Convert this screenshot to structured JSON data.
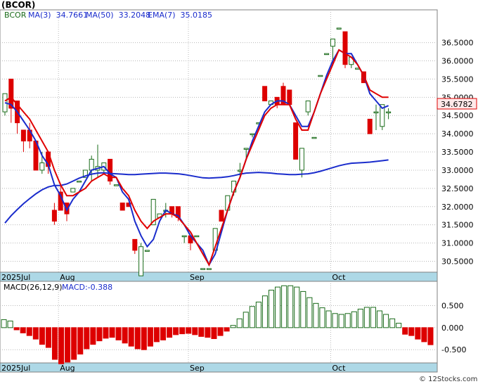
{
  "ticker_title": "(BCOR)",
  "watermark": "© 12Stocks.com",
  "colors": {
    "up": "#1a6b1a",
    "down": "#dd0000",
    "ma_fast": "#e00000",
    "ma_slow": "#1a2ccc",
    "axis_band": "#add8e6",
    "grid": "#b8b8b8",
    "price_tag_bg": "#ffe9e9",
    "macd_label": "#1a2ccc"
  },
  "chart_data": [
    {
      "type": "candlestick",
      "legend": {
        "symbol": "BCOR",
        "ma3": "MA(3)  34.7661",
        "ma50": "MA(50)  33.2048",
        "ema7": "EMA(7)  35.0185"
      },
      "last_price_tag": "34.6782",
      "ylim": [
        30.2,
        37.4
      ],
      "y_ticks": [
        "30.5000",
        "31.0000",
        "31.5000",
        "32.0000",
        "32.5000",
        "33.0000",
        "33.5000",
        "34.0000",
        "34.5000",
        "35.0000",
        "35.5000",
        "36.0000",
        "36.5000"
      ],
      "x_tick_labels": [
        {
          "label": "2025Jul",
          "index": 0
        },
        {
          "label": "Aug",
          "index": 9
        },
        {
          "label": "Sep",
          "index": 30
        },
        {
          "label": "Oct",
          "index": 53
        }
      ],
      "ohlc": [
        [
          34.6,
          35.1,
          34.5,
          35.1
        ],
        [
          35.5,
          35.5,
          34.3,
          34.7
        ],
        [
          34.9,
          34.9,
          34.0,
          34.3
        ],
        [
          34.1,
          34.1,
          33.5,
          33.8
        ],
        [
          34.1,
          34.3,
          33.6,
          33.8
        ],
        [
          33.8,
          33.8,
          33.0,
          33.0
        ],
        [
          33.0,
          33.5,
          32.9,
          33.2
        ],
        [
          33.5,
          33.5,
          32.9,
          33.1
        ],
        [
          31.9,
          32.1,
          31.5,
          31.6
        ],
        [
          32.4,
          32.6,
          31.9,
          31.9
        ],
        [
          32.1,
          32.1,
          31.6,
          31.8
        ],
        [
          32.4,
          32.5,
          32.4,
          32.5
        ],
        [
          32.7,
          32.7,
          32.7,
          32.7
        ],
        [
          32.8,
          33.0,
          32.8,
          33.0
        ],
        [
          33.0,
          33.4,
          32.7,
          33.3
        ],
        [
          33.0,
          33.7,
          32.8,
          33.1
        ],
        [
          33.0,
          33.2,
          32.9,
          33.2
        ],
        [
          33.3,
          33.3,
          32.6,
          32.7
        ],
        [
          32.6,
          32.6,
          32.6,
          32.6
        ],
        [
          32.1,
          32.1,
          31.9,
          31.9
        ],
        [
          32.1,
          32.1,
          32.0,
          32.0
        ],
        [
          31.1,
          31.1,
          30.7,
          30.8
        ],
        [
          30.1,
          31.0,
          30.1,
          30.9
        ],
        [
          30.8,
          30.8,
          30.8,
          30.8
        ],
        [
          31.5,
          32.2,
          31.5,
          32.2
        ],
        [
          31.7,
          31.8,
          31.7,
          31.8
        ],
        [
          31.9,
          32.1,
          31.7,
          31.9
        ],
        [
          32.0,
          32.0,
          31.7,
          31.8
        ],
        [
          32.0,
          32.0,
          31.6,
          31.7
        ],
        [
          31.2,
          31.2,
          31.0,
          31.2
        ],
        [
          31.2,
          31.2,
          30.8,
          31.0
        ],
        [
          31.2,
          31.2,
          31.2,
          31.2
        ],
        [
          30.3,
          30.3,
          30.3,
          30.3
        ],
        [
          30.3,
          30.3,
          30.3,
          30.3
        ],
        [
          30.8,
          31.4,
          30.8,
          31.4
        ],
        [
          31.9,
          31.9,
          31.6,
          31.6
        ],
        [
          31.9,
          32.3,
          31.9,
          32.3
        ],
        [
          32.4,
          32.7,
          32.3,
          32.7
        ],
        [
          33.0,
          33.2,
          32.8,
          33.0
        ],
        [
          33.6,
          33.6,
          33.3,
          33.6
        ],
        [
          34.0,
          34.0,
          33.9,
          34.0
        ],
        [
          34.3,
          34.3,
          34.3,
          34.3
        ],
        [
          35.3,
          35.3,
          34.9,
          34.9
        ],
        [
          34.8,
          34.9,
          34.8,
          34.9
        ],
        [
          35.0,
          35.0,
          34.7,
          34.8
        ],
        [
          35.3,
          35.4,
          34.8,
          34.8
        ],
        [
          35.2,
          35.2,
          34.8,
          34.8
        ],
        [
          34.3,
          34.3,
          33.3,
          33.3
        ],
        [
          33.0,
          33.6,
          32.8,
          33.6
        ],
        [
          34.6,
          34.9,
          34.5,
          34.9
        ],
        [
          33.9,
          33.9,
          33.9,
          33.9
        ],
        [
          35.6,
          35.6,
          35.6,
          35.6
        ],
        [
          36.2,
          36.2,
          36.2,
          36.2
        ],
        [
          36.4,
          36.6,
          35.9,
          36.6
        ],
        [
          36.9,
          36.9,
          36.9,
          36.9
        ],
        [
          36.8,
          36.8,
          35.8,
          35.9
        ],
        [
          35.9,
          36.1,
          35.8,
          36.1
        ],
        [
          35.8,
          35.8,
          35.8,
          35.8
        ],
        [
          35.7,
          35.7,
          35.4,
          35.4
        ],
        [
          34.4,
          34.4,
          34.0,
          34.0
        ],
        [
          34.6,
          34.8,
          34.1,
          34.6
        ],
        [
          34.2,
          34.8,
          34.1,
          34.8
        ],
        [
          34.6,
          34.7,
          34.4,
          34.6
        ]
      ],
      "ema7": [
        34.9,
        35.0,
        34.8,
        34.6,
        34.4,
        34.1,
        33.8,
        33.5,
        33.0,
        32.6,
        32.3,
        32.3,
        32.4,
        32.5,
        32.7,
        32.8,
        32.9,
        32.8,
        32.8,
        32.5,
        32.3,
        31.9,
        31.6,
        31.4,
        31.6,
        31.7,
        31.8,
        31.8,
        31.7,
        31.5,
        31.3,
        31.0,
        30.7,
        30.4,
        30.9,
        31.4,
        31.9,
        32.4,
        32.8,
        33.3,
        33.7,
        34.1,
        34.5,
        34.7,
        34.8,
        34.8,
        34.8,
        34.4,
        34.1,
        34.1,
        34.6,
        35.1,
        35.5,
        35.9,
        36.3,
        36.2,
        36.1,
        35.9,
        35.6,
        35.2,
        35.1,
        35.0,
        35.0
      ],
      "ma50": [
        31.55,
        31.75,
        31.92,
        32.08,
        32.22,
        32.35,
        32.46,
        32.54,
        32.58,
        32.58,
        32.62,
        32.7,
        32.78,
        32.84,
        32.89,
        32.92,
        32.93,
        32.91,
        32.9,
        32.89,
        32.88,
        32.88,
        32.89,
        32.9,
        32.91,
        32.92,
        32.92,
        32.91,
        32.9,
        32.88,
        32.85,
        32.82,
        32.79,
        32.78,
        32.79,
        32.8,
        32.82,
        32.85,
        32.89,
        32.92,
        32.93,
        32.94,
        32.93,
        32.92,
        32.9,
        32.89,
        32.88,
        32.88,
        32.89,
        32.9,
        32.93,
        32.97,
        33.02,
        33.07,
        33.12,
        33.16,
        33.19,
        33.2,
        33.21,
        33.22,
        33.24,
        33.26,
        33.28
      ],
      "ma3": [
        34.85,
        34.8,
        34.6,
        34.35,
        34.1,
        33.8,
        33.4,
        33.15,
        32.6,
        32.3,
        31.9,
        32.2,
        32.4,
        32.7,
        33.0,
        33.05,
        33.1,
        32.9,
        32.8,
        32.4,
        32.2,
        31.6,
        31.2,
        30.9,
        31.1,
        31.6,
        31.9,
        31.8,
        31.75,
        31.5,
        31.2,
        31.0,
        30.8,
        30.4,
        30.7,
        31.3,
        31.9,
        32.4,
        32.8,
        33.3,
        33.8,
        34.2,
        34.6,
        34.8,
        34.9,
        34.9,
        34.8,
        34.5,
        34.2,
        34.2,
        34.6,
        35.1,
        35.6,
        36.0,
        36.3,
        36.2,
        36.2,
        35.9,
        35.6,
        35.1,
        34.9,
        34.7,
        34.77
      ]
    },
    {
      "type": "bar",
      "legend": {
        "name": "MACD(26,12,9)",
        "value": "MACD:-0.388"
      },
      "ylim": [
        -0.8,
        1.05
      ],
      "y_ticks": [
        "0.500",
        "0.000",
        "-0.500"
      ],
      "x_tick_labels": [
        {
          "label": "2025Jul",
          "index": 0
        },
        {
          "label": "Aug",
          "index": 9
        },
        {
          "label": "Sep",
          "index": 30
        },
        {
          "label": "Oct",
          "index": 53
        }
      ],
      "values": [
        0.18,
        0.15,
        -0.05,
        -0.12,
        -0.18,
        -0.26,
        -0.38,
        -0.45,
        -0.72,
        -0.82,
        -0.78,
        -0.72,
        -0.6,
        -0.48,
        -0.38,
        -0.3,
        -0.24,
        -0.22,
        -0.28,
        -0.35,
        -0.42,
        -0.48,
        -0.5,
        -0.42,
        -0.32,
        -0.28,
        -0.22,
        -0.16,
        -0.14,
        -0.13,
        -0.16,
        -0.2,
        -0.22,
        -0.25,
        -0.18,
        -0.08,
        0.05,
        0.2,
        0.35,
        0.48,
        0.58,
        0.72,
        0.85,
        0.92,
        0.95,
        0.95,
        0.92,
        0.82,
        0.68,
        0.55,
        0.45,
        0.38,
        0.32,
        0.3,
        0.32,
        0.36,
        0.42,
        0.46,
        0.46,
        0.38,
        0.3,
        0.2,
        0.1,
        -0.15,
        -0.18,
        -0.26,
        -0.32,
        -0.388
      ]
    }
  ]
}
